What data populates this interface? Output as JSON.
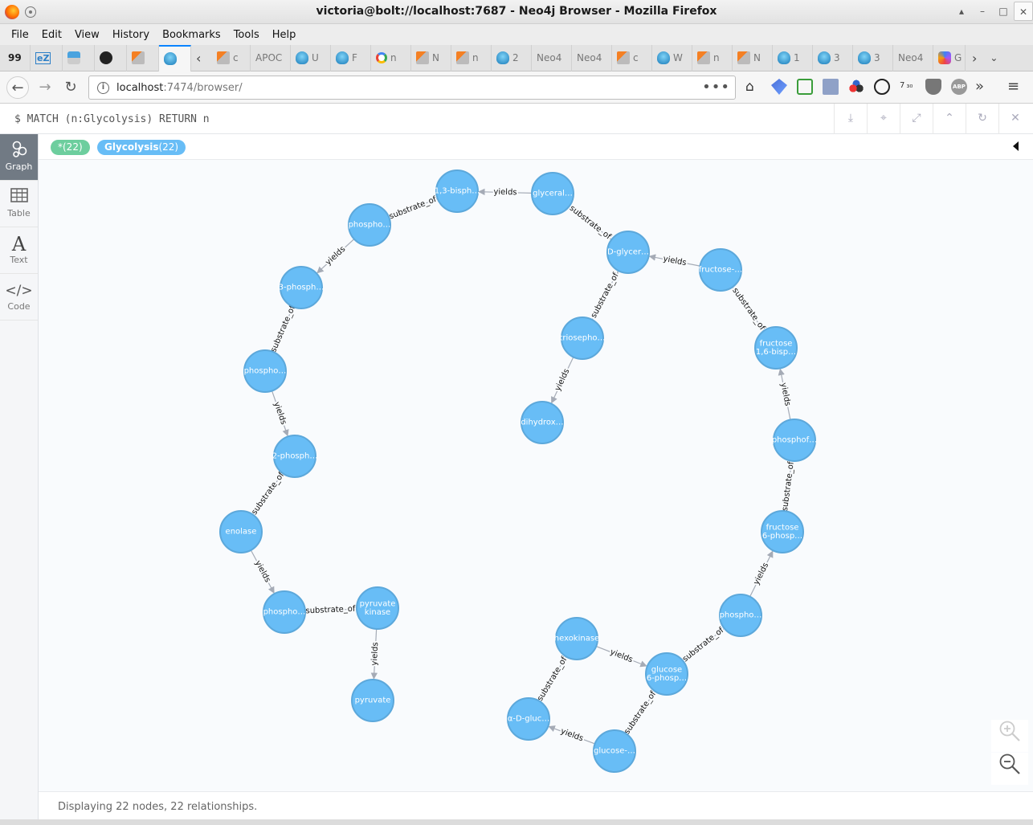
{
  "window": {
    "title": "victoria@bolt://localhost:7687 - Neo4j Browser - Mozilla Firefox",
    "controls": [
      "▴",
      "–",
      "□",
      "✕"
    ]
  },
  "menubar": [
    "File",
    "Edit",
    "View",
    "History",
    "Bookmarks",
    "Tools",
    "Help"
  ],
  "tabs": [
    {
      "icon": "quote-icon",
      "label": "99"
    },
    {
      "icon": "ez-icon",
      "label": "eZ"
    },
    {
      "icon": "screen-icon",
      "label": ""
    },
    {
      "icon": "github-icon",
      "label": ""
    },
    {
      "icon": "stackoverflow-icon",
      "label": ""
    },
    {
      "icon": "neo4j-icon",
      "label": "",
      "active": true
    },
    {
      "icon": "back-chevron-icon",
      "label": ""
    },
    {
      "icon": "stackoverflow-icon",
      "label": "c"
    },
    {
      "icon": "text",
      "label": "APOC"
    },
    {
      "icon": "neo4j-icon",
      "label": "U"
    },
    {
      "icon": "neo4j-icon",
      "label": "F"
    },
    {
      "icon": "google-icon",
      "label": "n"
    },
    {
      "icon": "stackoverflow-icon",
      "label": "N"
    },
    {
      "icon": "stackoverflow-icon",
      "label": "n"
    },
    {
      "icon": "neo4j-icon",
      "label": "2"
    },
    {
      "icon": "text",
      "label": "Neo4"
    },
    {
      "icon": "text",
      "label": "Neo4"
    },
    {
      "icon": "stackoverflow-icon",
      "label": "c"
    },
    {
      "icon": "neo4j-icon",
      "label": "W"
    },
    {
      "icon": "stackoverflow-icon",
      "label": "n"
    },
    {
      "icon": "stackoverflow-icon",
      "label": "N"
    },
    {
      "icon": "neo4j-icon",
      "label": "1"
    },
    {
      "icon": "neo4j-icon",
      "label": "3"
    },
    {
      "icon": "neo4j-icon",
      "label": "3"
    },
    {
      "icon": "text",
      "label": "Neo4"
    },
    {
      "icon": "grid-icon",
      "label": "G"
    }
  ],
  "navbar": {
    "url_host": "localhost",
    "url_path": ":7474/browser/",
    "counter_badge": "7 ₃₀"
  },
  "editor": {
    "query": "$ MATCH (n:Glycolysis) RETURN n",
    "frame_buttons": [
      "download-icon",
      "pin-icon",
      "collapse-fullscreen-icon",
      "chevron-up-icon",
      "rerun-icon",
      "close-icon"
    ]
  },
  "sidebar": {
    "tabs": [
      {
        "label": "Graph",
        "icon": "graph-icon",
        "active": true
      },
      {
        "label": "Table",
        "icon": "table-icon"
      },
      {
        "label": "Text",
        "icon": "text-icon"
      },
      {
        "label": "Code",
        "icon": "code-icon"
      }
    ]
  },
  "legend": {
    "all_label": "*(22)",
    "label_name": "Glycolysis",
    "label_count": "(22)"
  },
  "graph": {
    "node_color": "#68bdf6",
    "node_stroke": "#5ca8db",
    "edge_color": "#a5abb6",
    "nodes": [
      {
        "id": "bisph",
        "label": [
          "1,3-bisph…"
        ]
      },
      {
        "id": "glyceral",
        "label": [
          "glyceral…"
        ]
      },
      {
        "id": "phospho1",
        "label": [
          "phospho…"
        ]
      },
      {
        "id": "dglycer",
        "label": [
          "D-glycer…"
        ]
      },
      {
        "id": "fructose",
        "label": [
          "fructose-…"
        ]
      },
      {
        "id": "3phosph",
        "label": [
          "3-phosph…"
        ]
      },
      {
        "id": "triosepho",
        "label": [
          "triosepho…"
        ]
      },
      {
        "id": "fructose16",
        "label": [
          "fructose",
          "1,6-bisp…"
        ]
      },
      {
        "id": "phospho2",
        "label": [
          "phospho…"
        ]
      },
      {
        "id": "dihydrox",
        "label": [
          "dihydrox…"
        ]
      },
      {
        "id": "phosphof",
        "label": [
          "phosphof…"
        ]
      },
      {
        "id": "2phosph",
        "label": [
          "2-phosph…"
        ]
      },
      {
        "id": "enolase",
        "label": [
          "enolase"
        ]
      },
      {
        "id": "fructose6",
        "label": [
          "fructose",
          "6-phosp…"
        ]
      },
      {
        "id": "phospho3",
        "label": [
          "phospho…"
        ]
      },
      {
        "id": "pyrkinase",
        "label": [
          "pyruvate",
          "kinase"
        ]
      },
      {
        "id": "phospho4",
        "label": [
          "phospho…"
        ]
      },
      {
        "id": "hexokinase",
        "label": [
          "hexokinase"
        ]
      },
      {
        "id": "glucose6",
        "label": [
          "glucose",
          "6-phosp…"
        ]
      },
      {
        "id": "pyruvate",
        "label": [
          "pyruvate"
        ]
      },
      {
        "id": "adgluc",
        "label": [
          "α-D-gluc…"
        ]
      },
      {
        "id": "glucose",
        "label": [
          "glucose-…"
        ]
      }
    ],
    "edges": [
      {
        "from": "glyceral",
        "to": "bisph",
        "label": "yields"
      },
      {
        "from": "phospho1",
        "to": "bisph",
        "label": "substrate_of"
      },
      {
        "from": "phospho1",
        "to": "3phosph",
        "label": "yields"
      },
      {
        "from": "glyceral",
        "to": "dglycer",
        "label": "substrate_of"
      },
      {
        "from": "fructose",
        "to": "dglycer",
        "label": "yields"
      },
      {
        "from": "triosepho",
        "to": "dglycer",
        "label": "substrate_of"
      },
      {
        "from": "triosepho",
        "to": "dihydrox",
        "label": "yields"
      },
      {
        "from": "fructose16",
        "to": "fructose",
        "label": "substrate_of"
      },
      {
        "from": "phosphof",
        "to": "fructose16",
        "label": "yields"
      },
      {
        "from": "fructose6",
        "to": "phosphof",
        "label": "substrate_of"
      },
      {
        "from": "phospho3",
        "to": "fructose6",
        "label": "yields"
      },
      {
        "from": "glucose6",
        "to": "phospho3",
        "label": "substrate_of"
      },
      {
        "from": "hexokinase",
        "to": "glucose6",
        "label": "yields"
      },
      {
        "from": "adgluc",
        "to": "hexokinase",
        "label": "substrate_of"
      },
      {
        "from": "glucose",
        "to": "adgluc",
        "label": "yields"
      },
      {
        "from": "glucose",
        "to": "glucose6",
        "label": "substrate_of"
      },
      {
        "from": "3phosph",
        "to": "phospho2",
        "label": "substrate_of"
      },
      {
        "from": "phospho2",
        "to": "2phosph",
        "label": "yields"
      },
      {
        "from": "2phosph",
        "to": "enolase",
        "label": "substrate_of"
      },
      {
        "from": "enolase",
        "to": "phospho4",
        "label": "yields"
      },
      {
        "from": "phospho4",
        "to": "pyrkinase",
        "label": "substrate_of"
      },
      {
        "from": "pyrkinase",
        "to": "pyruvate",
        "label": "yields"
      }
    ]
  },
  "zoom": {
    "in_icon": "zoom-in-icon",
    "out_icon": "zoom-out-icon"
  },
  "status": "Displaying 22 nodes, 22 relationships."
}
